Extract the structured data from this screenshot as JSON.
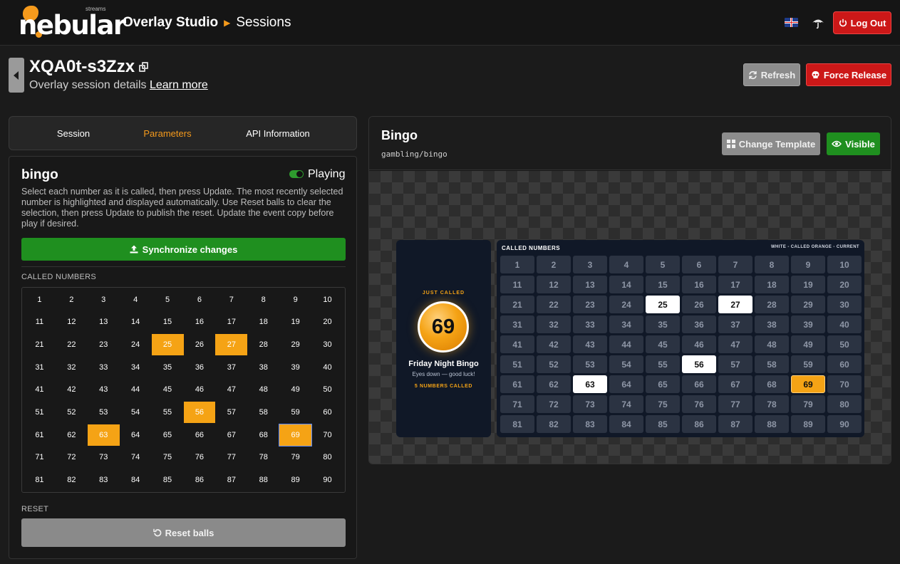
{
  "app": {
    "logo_text": "nebular",
    "logo_sub": "streams",
    "breadcrumb_studio": "Overlay Studio",
    "breadcrumb_page": "Sessions",
    "logout_label": "Log Out"
  },
  "header": {
    "session_id": "XQA0t-s3Zzx",
    "subtitle": "Overlay session details",
    "learn_more": "Learn more",
    "refresh_label": "Refresh",
    "force_release_label": "Force Release"
  },
  "tabs": [
    {
      "label": "Session",
      "active": false
    },
    {
      "label": "Parameters",
      "active": true
    },
    {
      "label": "API Information",
      "active": false
    }
  ],
  "params": {
    "template_name": "bingo",
    "status": "Playing",
    "description": "Select each number as it is called, then press Update. The most recently selected number is highlighted and displayed automatically. Use Reset balls to clear the selection, then press Update to publish the reset. Update the event copy before play if desired.",
    "sync_label": "Synchronize changes",
    "called_label": "CALLED NUMBERS",
    "reset_section_label": "RESET",
    "reset_button_label": "Reset balls",
    "selected_numbers": [
      25,
      27,
      56,
      63,
      69
    ],
    "current_number": 69
  },
  "preview": {
    "title": "Bingo",
    "path": "gambling/bingo",
    "change_template_label": "Change Template",
    "visible_label": "Visible"
  },
  "overlay": {
    "just_called": "JUST CALLED",
    "ball_number": "69",
    "event_title": "Friday Night Bingo",
    "event_subtitle": "Eyes down — good luck!",
    "numbers_called": "5 NUMBERS CALLED",
    "board_title": "CALLED NUMBERS",
    "legend": "WHITE - CALLED   ORANGE - CURRENT"
  },
  "colors": {
    "accent": "#f59a1c",
    "danger": "#cc1818",
    "success": "#1f8f1f"
  }
}
